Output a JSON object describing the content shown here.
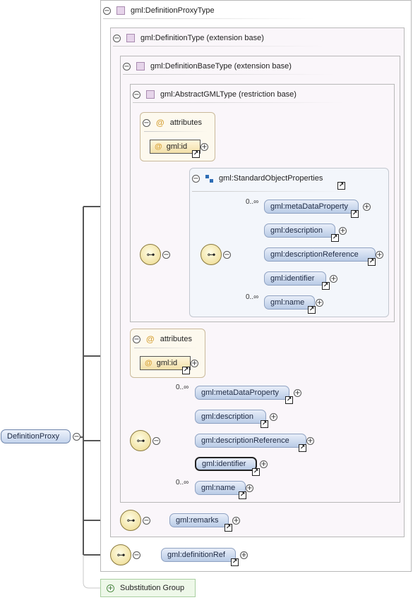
{
  "root_element": "DefinitionProxy",
  "types": {
    "proxy": "gml:DefinitionProxyType",
    "definition": "gml:DefinitionType (extension base)",
    "definition_base": "gml:DefinitionBaseType (extension base)",
    "abstract_gml": "gml:AbstractGMLType (restriction base)"
  },
  "group_name": "gml:StandardObjectProperties",
  "attributes_label": "attributes",
  "attr_id": "gml:id",
  "inner_elements": [
    {
      "name": "gml:metaDataProperty",
      "occurs": "0..∞"
    },
    {
      "name": "gml:description",
      "occurs": ""
    },
    {
      "name": "gml:descriptionReference",
      "occurs": ""
    },
    {
      "name": "gml:identifier",
      "occurs": ""
    },
    {
      "name": "gml:name",
      "occurs": "0..∞"
    }
  ],
  "outer_elements": [
    {
      "name": "gml:metaDataProperty",
      "occurs": "0..∞"
    },
    {
      "name": "gml:description",
      "occurs": ""
    },
    {
      "name": "gml:descriptionReference",
      "occurs": ""
    },
    {
      "name": "gml:identifier",
      "occurs": ""
    },
    {
      "name": "gml:name",
      "occurs": "0..∞"
    }
  ],
  "remarks": "gml:remarks",
  "definition_ref": "gml:definitionRef",
  "substitution_group": "Substitution Group",
  "symbols": {
    "minus": "−",
    "plus": "+",
    "at": "@",
    "ref_arrow": "↗",
    "sequence": "⊶"
  },
  "colors": {
    "element_fill": "#b9cbe6",
    "compositor_fill": "#f1e2a3",
    "attribute_fill": "#f2dfa8",
    "type_square": "#e6d4ea",
    "group_icon": "#2d6db5",
    "substitution_fill": "#eef8e9"
  }
}
